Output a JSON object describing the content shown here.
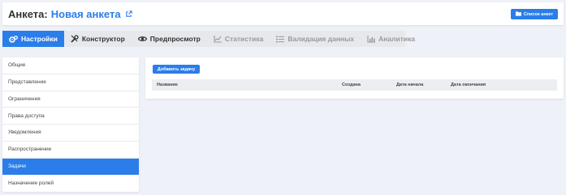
{
  "header": {
    "prefix": "Анкета:",
    "form_name": "Новая анкета",
    "list_button": "Список анкет"
  },
  "tabs": [
    {
      "label": "Настройки",
      "state": "active"
    },
    {
      "label": "Конструктор",
      "state": "normal"
    },
    {
      "label": "Предпросмотр",
      "state": "normal"
    },
    {
      "label": "Статистика",
      "state": "disabled"
    },
    {
      "label": "Валидация данных",
      "state": "disabled"
    },
    {
      "label": "Аналитика",
      "state": "disabled"
    }
  ],
  "sidebar": {
    "items": [
      {
        "label": "Общие"
      },
      {
        "label": "Представление"
      },
      {
        "label": "Ограничения"
      },
      {
        "label": "Права доступа"
      },
      {
        "label": "Уведомления"
      },
      {
        "label": "Распространение"
      },
      {
        "label": "Задачи",
        "active": true
      },
      {
        "label": "Назначение ролей"
      }
    ]
  },
  "tasks": {
    "add_button": "Добавить задачу",
    "columns": [
      "Название",
      "Создана",
      "Дата начала",
      "Дата окончания"
    ]
  },
  "colors": {
    "accent": "#2b7de9",
    "background": "#eef1f7"
  }
}
